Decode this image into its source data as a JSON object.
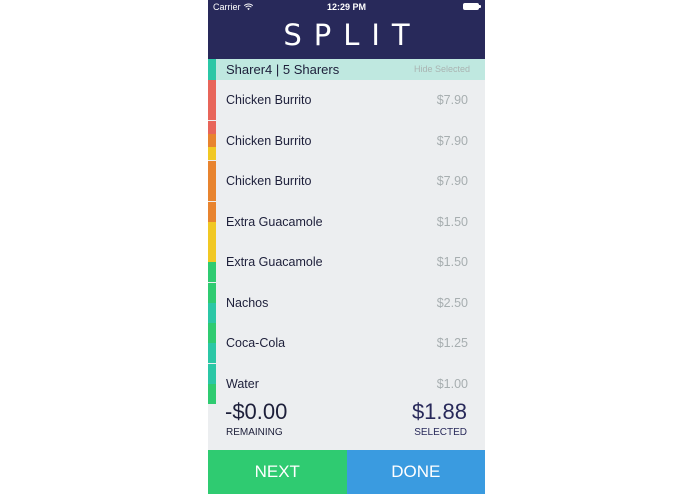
{
  "status_bar": {
    "carrier": "Carrier",
    "time": "12:29 PM"
  },
  "app": {
    "title": "SPLIT"
  },
  "sharer": {
    "label": "Sharer4  |  5 Sharers",
    "color": "#2bc7a6",
    "hide_selected_label": "Hide Selected"
  },
  "items": [
    {
      "name": "Chicken Burrito",
      "price": "$7.90",
      "colors": [
        "#e8655a"
      ]
    },
    {
      "name": "Chicken Burrito",
      "price": "$7.90",
      "colors": [
        "#e8655a",
        "#e8842f",
        "#f1c824"
      ]
    },
    {
      "name": "Chicken Burrito",
      "price": "$7.90",
      "colors": [
        "#e8842f"
      ]
    },
    {
      "name": "Extra Guacamole",
      "price": "$1.50",
      "colors": [
        "#e8842f",
        "#f1c824"
      ]
    },
    {
      "name": "Extra Guacamole",
      "price": "$1.50",
      "colors": [
        "#f1c824",
        "#2fcb71"
      ]
    },
    {
      "name": "Nachos",
      "price": "$2.50",
      "colors": [
        "#2fcb71",
        "#2bc7a6"
      ]
    },
    {
      "name": "Coca-Cola",
      "price": "$1.25",
      "colors": [
        "#2fcb71",
        "#2bc7a6"
      ]
    },
    {
      "name": "Water",
      "price": "$1.00",
      "colors": [
        "#2bc7a6",
        "#2fcb71"
      ]
    }
  ],
  "totals": {
    "remaining_amount": "-$0.00",
    "remaining_label": "REMAINING",
    "selected_amount": "$1.88",
    "selected_label": "SELECTED"
  },
  "actions": {
    "next_label": "NEXT",
    "done_label": "DONE"
  },
  "colors": {
    "header": "#28295a",
    "next": "#2fcb71",
    "done": "#3a9be0"
  }
}
